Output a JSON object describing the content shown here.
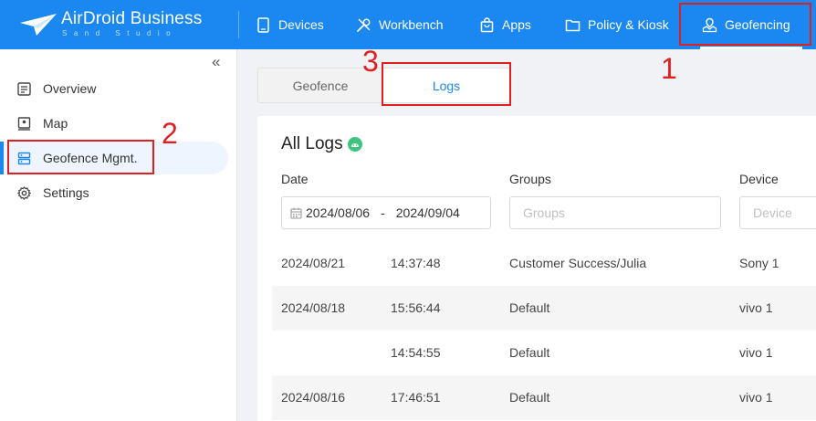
{
  "header": {
    "logo_text": "AirDroid Business",
    "logo_sub": "Sand Studio",
    "nav": [
      {
        "label": "Devices",
        "icon": "phone-icon"
      },
      {
        "label": "Workbench",
        "icon": "tools-icon"
      },
      {
        "label": "Apps",
        "icon": "bag-icon"
      },
      {
        "label": "Policy & Kiosk",
        "icon": "folder-icon"
      },
      {
        "label": "Geofencing",
        "icon": "location-hand-icon",
        "active": true
      }
    ]
  },
  "sidebar": {
    "collapse_icon": "«",
    "items": [
      {
        "label": "Overview",
        "icon": "list-icon"
      },
      {
        "label": "Map",
        "icon": "map-pin-icon"
      },
      {
        "label": "Geofence Mgmt.",
        "icon": "server-icon",
        "active": true
      },
      {
        "label": "Settings",
        "icon": "gear-icon"
      }
    ]
  },
  "tabs": {
    "geofence": "Geofence",
    "logs": "Logs",
    "active": "Logs"
  },
  "logs": {
    "title": "All Logs",
    "filters": {
      "date_label": "Date",
      "date_start": "2024/08/06",
      "date_sep": "-",
      "date_end": "2024/09/04",
      "groups_label": "Groups",
      "groups_placeholder": "Groups",
      "device_label": "Device",
      "device_placeholder": "Device"
    },
    "rows": [
      {
        "date": "2024/08/21",
        "time": "14:37:48",
        "group": "Customer Success/Julia",
        "device": "Sony 1"
      },
      {
        "date": "2024/08/18",
        "time": "15:56:44",
        "group": "Default",
        "device": "vivo 1"
      },
      {
        "date": "",
        "time": "14:54:55",
        "group": "Default",
        "device": "vivo 1"
      },
      {
        "date": "2024/08/16",
        "time": "17:46:51",
        "group": "Default",
        "device": "vivo 1"
      }
    ]
  },
  "annotations": [
    "1",
    "2",
    "3"
  ],
  "colors": {
    "brand": "#1a88f0",
    "annotation": "#e02020",
    "android": "#3ec47e"
  }
}
